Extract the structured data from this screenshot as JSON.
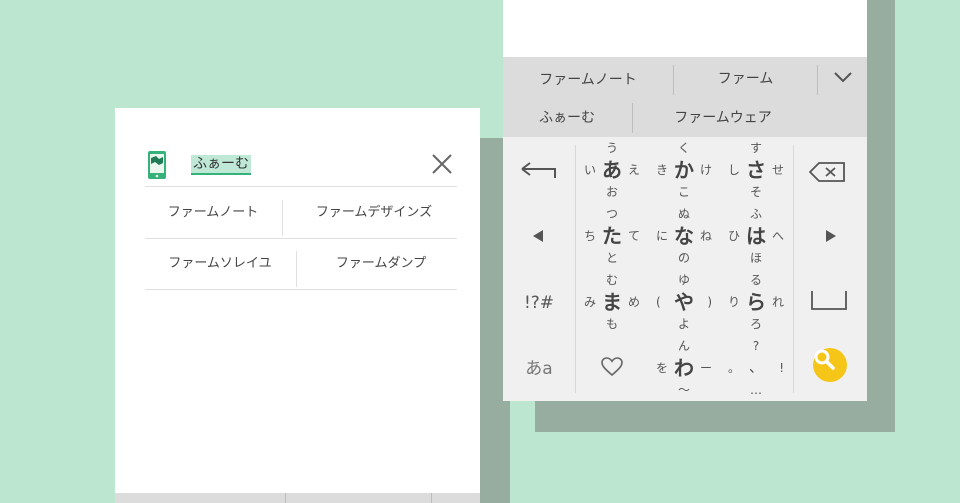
{
  "search_panel": {
    "query": "ふぁーむ",
    "icon": "phone-map-icon",
    "clear_icon": "close-icon",
    "suggestions": [
      [
        "ファームノート",
        "ファームデザインズ"
      ],
      [
        "ファームソレイユ",
        "ファームダンプ"
      ]
    ]
  },
  "keyboard": {
    "candidates_row1": [
      "ファームノート",
      "ファーム"
    ],
    "candidates_row2": [
      "ふぁーむ",
      "ファームウェア"
    ],
    "expand_icon": "chevron-down-icon",
    "kana_keys": [
      {
        "c": "あ",
        "t": "う",
        "b": "お",
        "l": "い",
        "r": "え"
      },
      {
        "c": "か",
        "t": "く",
        "b": "こ",
        "l": "き",
        "r": "け"
      },
      {
        "c": "さ",
        "t": "す",
        "b": "そ",
        "l": "し",
        "r": "せ"
      },
      {
        "c": "た",
        "t": "つ",
        "b": "と",
        "l": "ち",
        "r": "て"
      },
      {
        "c": "な",
        "t": "ぬ",
        "b": "の",
        "l": "に",
        "r": "ね"
      },
      {
        "c": "は",
        "t": "ふ",
        "b": "ほ",
        "l": "ひ",
        "r": "へ"
      },
      {
        "c": "ま",
        "t": "む",
        "b": "も",
        "l": "み",
        "r": "め"
      },
      {
        "c": "や",
        "t": "ゆ",
        "b": "よ",
        "l": "(",
        "r": ")"
      },
      {
        "c": "ら",
        "t": "る",
        "b": "ろ",
        "l": "り",
        "r": "れ"
      },
      {
        "c": "わ",
        "t": "ん",
        "b": "～",
        "l": "を",
        "r": "ー"
      },
      {
        "c": "、",
        "t": "?",
        "b": "…",
        "l": "。",
        "r": "!"
      }
    ],
    "symbols_label": "!?#",
    "mode_label": "あa",
    "left_keys": [
      "undo-arrow-icon",
      "left-arrow-icon",
      "symbols",
      "mode"
    ],
    "right_keys": [
      "backspace-icon",
      "right-arrow-icon",
      "space-icon",
      "search-icon"
    ],
    "emoji_icon": "heart-icon",
    "accent_color": "#f5c518",
    "brand_color": "#35b279"
  }
}
